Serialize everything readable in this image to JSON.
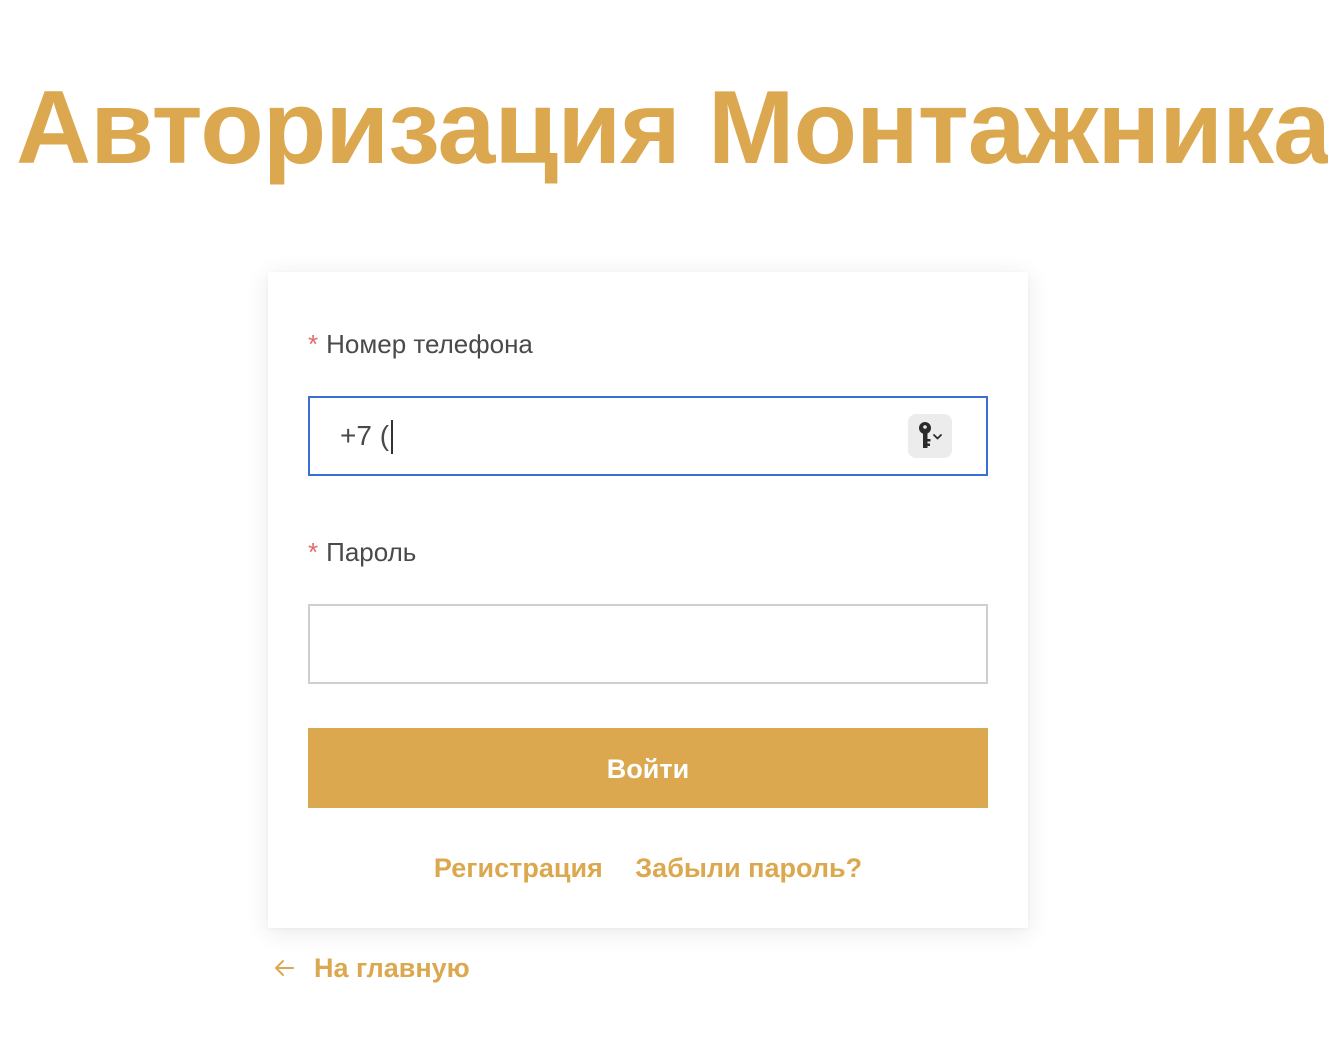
{
  "header": {
    "title": "Авторизация Монтажника"
  },
  "form": {
    "phone": {
      "required_mark": "*",
      "label": "Номер телефона",
      "value": "+7 ("
    },
    "password": {
      "required_mark": "*",
      "label": "Пароль",
      "value": ""
    },
    "submit_label": "Войти"
  },
  "links": {
    "register": "Регистрация",
    "forgot_password": "Забыли пароль?"
  },
  "footer": {
    "back_label": "На главную"
  },
  "icons": {
    "password_manager": "key-icon",
    "dropdown": "chevron-down-icon",
    "back": "arrow-left-icon"
  },
  "colors": {
    "accent": "#dca84f",
    "focus_border": "#3b6fd0",
    "required": "#e46a6a",
    "input_border": "#cfcfcf",
    "text": "#4a4a4a"
  }
}
